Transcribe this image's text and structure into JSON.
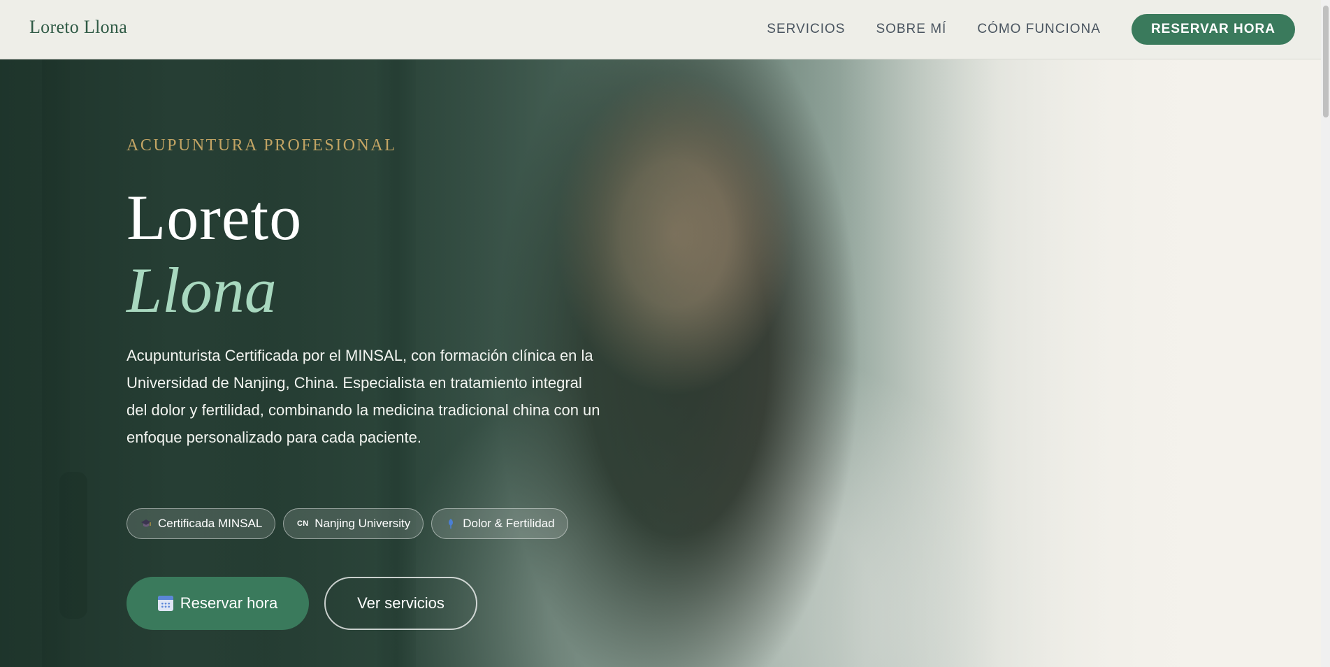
{
  "header": {
    "brand": "Loreto Llona",
    "nav": [
      {
        "label": "SERVICIOS"
      },
      {
        "label": "SOBRE MÍ"
      },
      {
        "label": "CÓMO FUNCIONA"
      }
    ],
    "cta_label": "RESERVAR HORA"
  },
  "hero": {
    "eyebrow": "ACUPUNTURA PROFESIONAL",
    "title_line1": "Loreto",
    "title_line2": "Llona",
    "description": "Acupunturista Certificada por el MINSAL, con formación clínica en la Universidad de Nanjing, China. Especialista en tratamiento integral del dolor y fertilidad, combinando la medicina tradicional china con un enfoque personalizado para cada paciente.",
    "badges": [
      {
        "icon": "graduation-cap-icon",
        "label": "Certificada MINSAL"
      },
      {
        "icon": "cn-flag-icon",
        "icon_text": "CN",
        "label": "Nanjing University"
      },
      {
        "icon": "leaf-icon",
        "label": "Dolor & Fertilidad"
      }
    ],
    "primary_button": {
      "icon": "calendar-icon",
      "label": "Reservar hora"
    },
    "secondary_button": {
      "label": "Ver servicios"
    }
  },
  "colors": {
    "accent": "#3a7a5c",
    "gold": "#c2a464",
    "mint": "#a8d8bf",
    "header_bg": "#eeeee8"
  }
}
